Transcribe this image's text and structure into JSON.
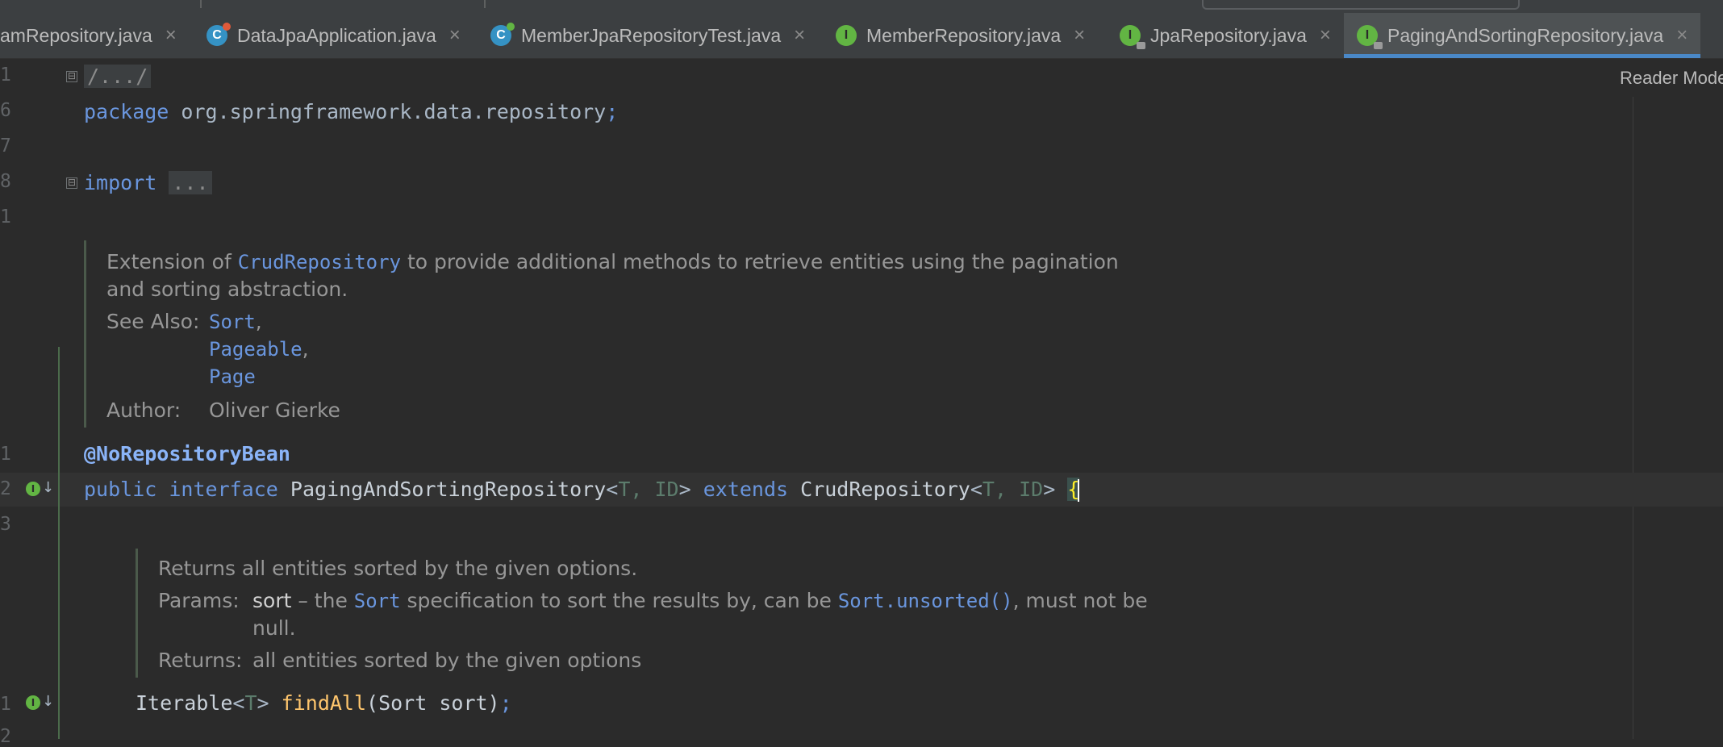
{
  "tabs": [
    {
      "label": "amRepository.java",
      "icon": "none",
      "active": false
    },
    {
      "label": "DataJpaApplication.java",
      "icon": "class-icon",
      "active": false
    },
    {
      "label": "MemberJpaRepositoryTest.java",
      "icon": "test-class-icon",
      "active": false
    },
    {
      "label": "MemberRepository.java",
      "icon": "interface-icon",
      "active": false
    },
    {
      "label": "JpaRepository.java",
      "icon": "interface-locked-icon",
      "active": false
    },
    {
      "label": "PagingAndSortingRepository.java",
      "icon": "interface-locked-icon",
      "active": true
    }
  ],
  "tab_close_glyph": "×",
  "reader_mode": "Reader Mode",
  "gutter": {
    "line_numbers": [
      "1",
      "6",
      "7",
      "8",
      "1",
      "1",
      "2",
      "3",
      "1",
      "2"
    ],
    "fold_glyph": "⊟",
    "impl_glyph": "I",
    "arrow_glyph": "↓"
  },
  "code": {
    "header_fold": "/.../",
    "package_kw": "package",
    "package_name": "org.springframework.data.repository",
    "semicolon": ";",
    "import_kw": "import",
    "import_fold": "...",
    "annotation": "@NoRepositoryBean",
    "decl": {
      "public": "public",
      "interface": "interface",
      "name": "PagingAndSortingRepository",
      "lt": "<",
      "t": "T",
      "comma": ", ",
      "id": "ID",
      "gt": ">",
      "extends": "extends",
      "parent": "CrudRepository",
      "brace": "{"
    },
    "method": {
      "ret_type": "Iterable",
      "lt": "<",
      "t": "T",
      "gt": ">",
      "name": "findAll",
      "params": "(Sort sort)",
      "semicolon": ";"
    }
  },
  "doc1": {
    "line1_pre": "Extension of ",
    "line1_link": "CrudRepository",
    "line1_post": " to provide additional methods to retrieve entities using the pagination",
    "line2": "and sorting abstraction.",
    "see_also_label": "See Also:",
    "see_also": [
      "Sort",
      "Pageable",
      "Page"
    ],
    "see_also_sep": ",",
    "author_label": "Author:",
    "author": "Oliver Gierke"
  },
  "doc2": {
    "line1": "Returns all entities sorted by the given options.",
    "params_label": "Params:",
    "param_name": "sort",
    "param_pre": " – the ",
    "param_link": "Sort",
    "param_mid": " specification to sort the results by, can be ",
    "param_link2": "Sort.unsorted()",
    "param_post": ", must not be",
    "param_line2": "null.",
    "returns_label": "Returns:",
    "returns": "all entities sorted by the given options"
  }
}
